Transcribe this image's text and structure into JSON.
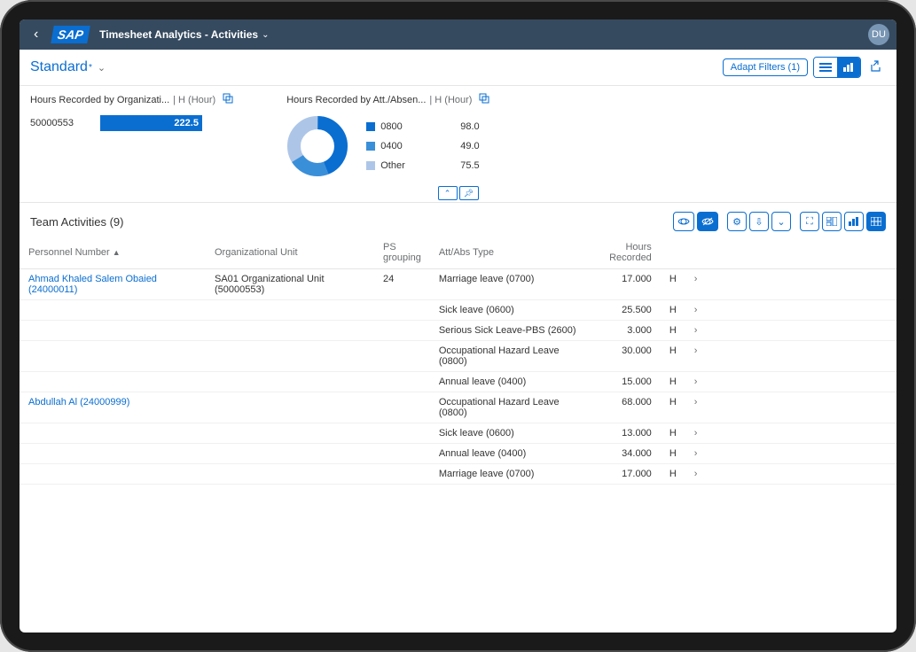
{
  "header": {
    "title": "Timesheet Analytics - Activities",
    "avatar": "DU"
  },
  "filterBar": {
    "variant": "Standard",
    "dirty": "*",
    "adaptFilters": "Adapt Filters (1)"
  },
  "chart_data": [
    {
      "type": "bar",
      "title": "Hours Recorded by Organizati...",
      "unit": "| H (Hour)",
      "categories": [
        "50000553"
      ],
      "values": [
        222.5
      ],
      "valueLabel": "222.5",
      "xlim": [
        0,
        222.5
      ]
    },
    {
      "type": "pie",
      "title": "Hours Recorded by Att./Absen...",
      "unit": "| H (Hour)",
      "series": [
        {
          "name": "0800",
          "value": 98.0,
          "color": "#0a6ed1",
          "label": "98.0"
        },
        {
          "name": "0400",
          "value": 49.0,
          "color": "#3a8fd9",
          "label": "49.0"
        },
        {
          "name": "Other",
          "value": 75.5,
          "color": "#adc6e8",
          "label": "75.5"
        }
      ]
    }
  ],
  "tableTitle": "Team Activities (9)",
  "columns": {
    "c0": "Personnel Number",
    "c1": "Organizational Unit",
    "c2": "PS grouping",
    "c3": "Att/Abs Type",
    "c4": "Hours Recorded"
  },
  "groups": [
    {
      "personnel": "Ahmad Khaled Salem Obaied (24000011)",
      "orgUnit": "SA01 Organizational Unit (50000553)",
      "psGroup": "24",
      "rows": [
        {
          "attType": "Marriage leave (0700)",
          "hours": "17.000",
          "unit": "H"
        },
        {
          "attType": "Sick leave (0600)",
          "hours": "25.500",
          "unit": "H"
        },
        {
          "attType": "Serious Sick Leave-PBS (2600)",
          "hours": "3.000",
          "unit": "H"
        },
        {
          "attType": "Occupational Hazard Leave (0800)",
          "hours": "30.000",
          "unit": "H"
        },
        {
          "attType": "Annual leave (0400)",
          "hours": "15.000",
          "unit": "H"
        }
      ]
    },
    {
      "personnel": "Abdullah Al (24000999)",
      "orgUnit": "",
      "psGroup": "",
      "rows": [
        {
          "attType": "Occupational Hazard Leave (0800)",
          "hours": "68.000",
          "unit": "H"
        },
        {
          "attType": "Sick leave (0600)",
          "hours": "13.000",
          "unit": "H"
        },
        {
          "attType": "Annual leave (0400)",
          "hours": "34.000",
          "unit": "H"
        },
        {
          "attType": "Marriage leave (0700)",
          "hours": "17.000",
          "unit": "H"
        }
      ]
    }
  ]
}
